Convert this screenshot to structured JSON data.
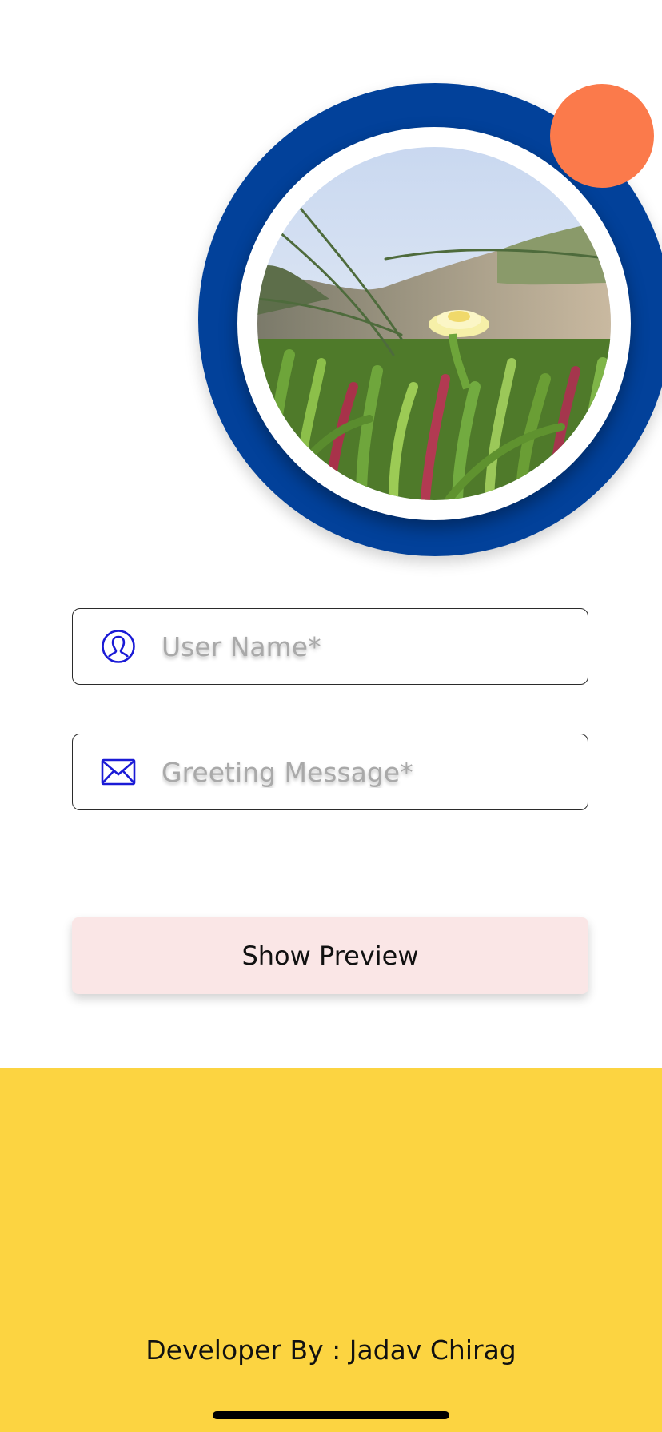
{
  "form": {
    "username": {
      "placeholder": "User Name*",
      "value": ""
    },
    "greeting": {
      "placeholder": "Greeting Message*",
      "value": ""
    }
  },
  "actions": {
    "preview_label": "Show Preview"
  },
  "footer": {
    "credit": "Developer By : Jadav Chirag"
  },
  "icons": {
    "username": "user-circle-icon",
    "greeting": "envelope-icon"
  },
  "colors": {
    "ring": "#02419a",
    "accent_dot": "#fb7a4b",
    "footer_bg": "#fcd441",
    "button_bg": "#fae6e6",
    "icon": "#1a1ad6"
  }
}
